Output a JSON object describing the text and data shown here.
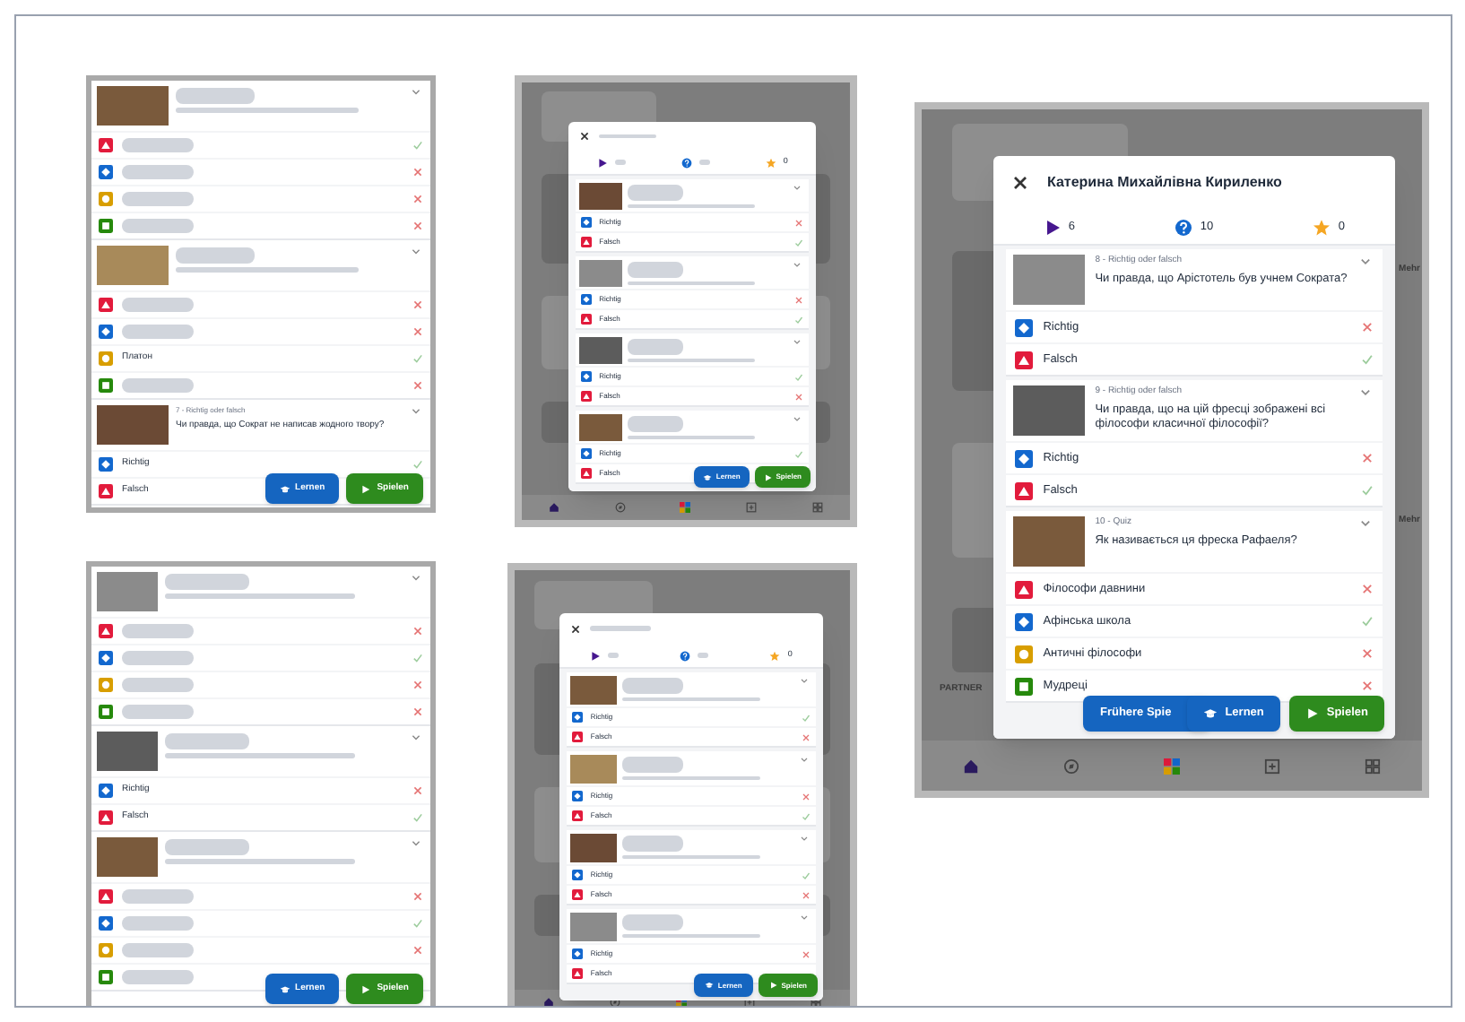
{
  "panels": [
    {
      "kind": "list",
      "questions": [
        {
          "answers": [
            {
              "kind": "triangle",
              "correct": true
            },
            {
              "kind": "diamond",
              "correct": false
            },
            {
              "kind": "circle",
              "correct": false
            },
            {
              "kind": "square",
              "correct": false
            }
          ]
        },
        {
          "answers": [
            {
              "kind": "triangle",
              "correct": false
            },
            {
              "kind": "diamond",
              "correct": false
            },
            {
              "kind": "circle",
              "label": "Платон",
              "correct": true
            },
            {
              "kind": "square",
              "correct": false
            }
          ]
        },
        {
          "label": "7 - Richtig oder falsch",
          "text": "Чи правда, що Сократ не написав жодного твору?",
          "answers": [
            {
              "kind": "diamond",
              "label": "Richtig",
              "correct": true
            },
            {
              "kind": "triangle",
              "label": "Falsch"
            }
          ]
        }
      ],
      "buttons": [
        {
          "kind": "learn",
          "label": "Lernen"
        },
        {
          "kind": "play",
          "label": "Spielen"
        }
      ]
    },
    {
      "kind": "modal",
      "stats": [
        {
          "kind": "plays"
        },
        {
          "kind": "questions"
        },
        {
          "kind": "stars",
          "value": "0"
        }
      ],
      "questions": [
        {
          "answers": [
            {
              "kind": "diamond",
              "label": "Richtig",
              "correct": false
            },
            {
              "kind": "triangle",
              "label": "Falsch",
              "correct": true
            }
          ]
        },
        {
          "answers": [
            {
              "kind": "diamond",
              "label": "Richtig",
              "correct": false
            },
            {
              "kind": "triangle",
              "label": "Falsch",
              "correct": true
            }
          ]
        },
        {
          "answers": [
            {
              "kind": "diamond",
              "label": "Richtig",
              "correct": true
            },
            {
              "kind": "triangle",
              "label": "Falsch",
              "correct": false
            }
          ]
        },
        {
          "answers": [
            {
              "kind": "diamond",
              "label": "Richtig",
              "correct": true
            },
            {
              "kind": "triangle",
              "label": "Falsch"
            }
          ]
        }
      ],
      "buttons": [
        {
          "kind": "learn",
          "label": "Lernen"
        },
        {
          "kind": "play",
          "label": "Spielen"
        }
      ]
    },
    {
      "kind": "modal",
      "title": "Катерина Михайлівна Кириленко",
      "stats": [
        {
          "kind": "plays",
          "value": "6"
        },
        {
          "kind": "questions",
          "value": "10"
        },
        {
          "kind": "stars",
          "value": "0"
        }
      ],
      "questions": [
        {
          "label": "8 - Richtig oder falsch",
          "text": "Чи правда, що Арістотель був учнем Сократа?",
          "answers": [
            {
              "kind": "diamond",
              "label": "Richtig",
              "correct": false
            },
            {
              "kind": "triangle",
              "label": "Falsch",
              "correct": true
            }
          ]
        },
        {
          "label": "9 - Richtig oder falsch",
          "text": "Чи правда, що на цій фресці зображені всі філософи класичної філософії?",
          "answers": [
            {
              "kind": "diamond",
              "label": "Richtig",
              "correct": false
            },
            {
              "kind": "triangle",
              "label": "Falsch",
              "correct": true
            }
          ]
        },
        {
          "label": "10 - Quiz",
          "text": "Як називається ця фреска Рафаеля?",
          "answers": [
            {
              "kind": "triangle",
              "label": "Філософи давнини",
              "correct": false
            },
            {
              "kind": "diamond",
              "label": "Афінська школа",
              "correct": true
            },
            {
              "kind": "circle",
              "label": "Античні філософи",
              "correct": false
            },
            {
              "kind": "square",
              "label": "Мудреці",
              "correct": false
            }
          ]
        }
      ],
      "buttons": [
        {
          "kind": "history",
          "label": "Frühere Spie"
        },
        {
          "kind": "learn",
          "label": "Lernen"
        },
        {
          "kind": "play",
          "label": "Spielen"
        }
      ],
      "background_texts": [
        "Mehr",
        "Mehr",
        "PARTNER"
      ]
    },
    {
      "kind": "list",
      "questions": [
        {
          "answers": [
            {
              "kind": "triangle",
              "correct": false
            },
            {
              "kind": "diamond",
              "correct": true
            },
            {
              "kind": "circle",
              "correct": false
            },
            {
              "kind": "square",
              "correct": false
            }
          ]
        },
        {
          "answers": [
            {
              "kind": "diamond",
              "label": "Richtig",
              "correct": false
            },
            {
              "kind": "triangle",
              "label": "Falsch",
              "correct": true
            }
          ]
        },
        {
          "answers": [
            {
              "kind": "triangle",
              "correct": false
            },
            {
              "kind": "diamond",
              "correct": true
            },
            {
              "kind": "circle",
              "correct": false
            },
            {
              "kind": "square"
            }
          ]
        }
      ],
      "buttons": [
        {
          "kind": "learn",
          "label": "Lernen"
        },
        {
          "kind": "play",
          "label": "Spielen"
        }
      ]
    },
    {
      "kind": "modal",
      "stats": [
        {
          "kind": "plays"
        },
        {
          "kind": "questions"
        },
        {
          "kind": "stars",
          "value": "0"
        }
      ],
      "questions": [
        {
          "answers": [
            {
              "kind": "diamond",
              "label": "Richtig",
              "correct": true
            },
            {
              "kind": "triangle",
              "label": "Falsch",
              "correct": false
            }
          ]
        },
        {
          "answers": [
            {
              "kind": "diamond",
              "label": "Richtig",
              "correct": false
            },
            {
              "kind": "triangle",
              "label": "Falsch",
              "correct": true
            }
          ]
        },
        {
          "answers": [
            {
              "kind": "diamond",
              "label": "Richtig",
              "correct": true
            },
            {
              "kind": "triangle",
              "label": "Falsch",
              "correct": false
            }
          ]
        },
        {
          "answers": [
            {
              "kind": "diamond",
              "label": "Richtig",
              "correct": false
            },
            {
              "kind": "triangle",
              "label": "Falsch"
            }
          ]
        }
      ],
      "buttons": [
        {
          "kind": "learn",
          "label": "Lernen"
        },
        {
          "kind": "play",
          "label": "Spielen"
        }
      ]
    }
  ]
}
